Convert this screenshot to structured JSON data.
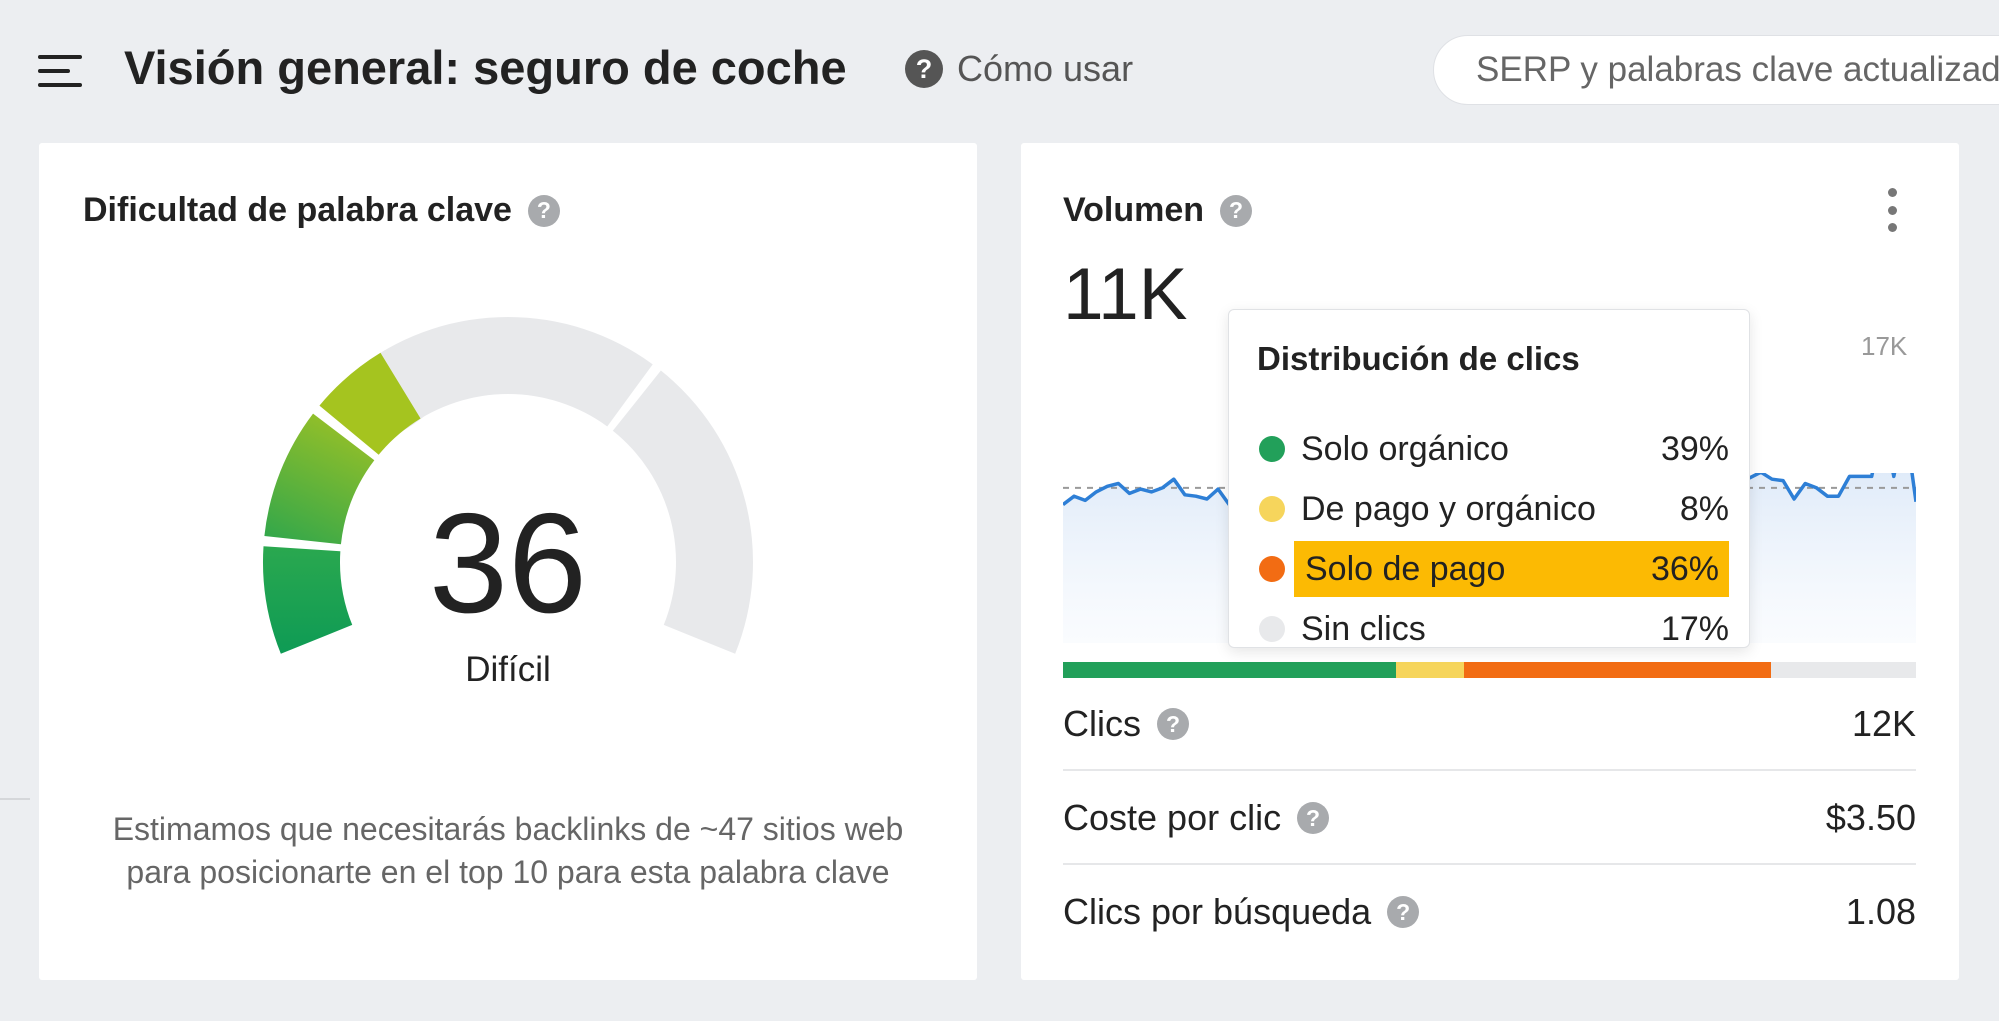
{
  "header": {
    "title": "Visión general: seguro de coche",
    "how_to_label": "Cómo usar",
    "serp_status": "SERP y palabras clave actualizadas"
  },
  "kd_card": {
    "title": "Dificultad de palabra clave",
    "score": "36",
    "score_value": 36,
    "difficulty_label": "Difícil",
    "description": "Estimamos que necesitarás backlinks de ~47 sitios web para posicionarte en el top 10 para esta palabra clave"
  },
  "volume_card": {
    "title": "Volumen",
    "value": "11K",
    "chart_max_label": "17K",
    "metrics": [
      {
        "label": "Clics",
        "value": "12K"
      },
      {
        "label": "Coste por clic",
        "value": "$3.50"
      },
      {
        "label": "Clics por búsqueda",
        "value": "1.08"
      }
    ],
    "click_distribution": {
      "title": "Distribución de clics",
      "items": [
        {
          "name": "Solo orgánico",
          "pct": "39%",
          "value": 39,
          "color": "#22a05a"
        },
        {
          "name": "De pago y orgánico",
          "pct": "8%",
          "value": 8,
          "color": "#f6d55c"
        },
        {
          "name": "Solo de pago",
          "pct": "36%",
          "value": 36,
          "color": "#f26c13",
          "highlighted": true
        },
        {
          "name": "Sin clics",
          "pct": "17%",
          "value": 17,
          "color": "#e8e9eb"
        }
      ]
    }
  },
  "colors": {
    "highlight": "#fcba03",
    "line": "#2e7fd6",
    "gauge_track": "#e8e9eb"
  },
  "chart_data": {
    "type": "line",
    "title": "",
    "ylim": [
      0,
      17000
    ],
    "series": [
      {
        "values": [
          9800,
          10400,
          10100,
          10700,
          11100,
          11300,
          10600,
          10900,
          10700,
          11000,
          11600,
          10500,
          10400,
          10200,
          10900,
          9800,
          10500,
          10200,
          10600,
          11100,
          10900,
          10500,
          10300,
          10200,
          10600,
          10900,
          10500,
          10400,
          10800,
          11000,
          10900,
          10700,
          10600,
          10800,
          10500,
          10700,
          11000,
          10900,
          10600,
          10700,
          10500,
          10800,
          11100,
          10900,
          10800,
          10600,
          10900,
          10700,
          10600,
          10900,
          11200,
          11600,
          11900,
          11400,
          11700,
          10000,
          11300,
          10800,
          10600,
          10900,
          11800,
          11700,
          11700,
          12100,
          11600,
          11500,
          10200,
          11300,
          11000,
          10400,
          10400,
          11800,
          11800,
          11800,
          15700,
          11800,
          15700,
          10000
        ]
      }
    ]
  }
}
